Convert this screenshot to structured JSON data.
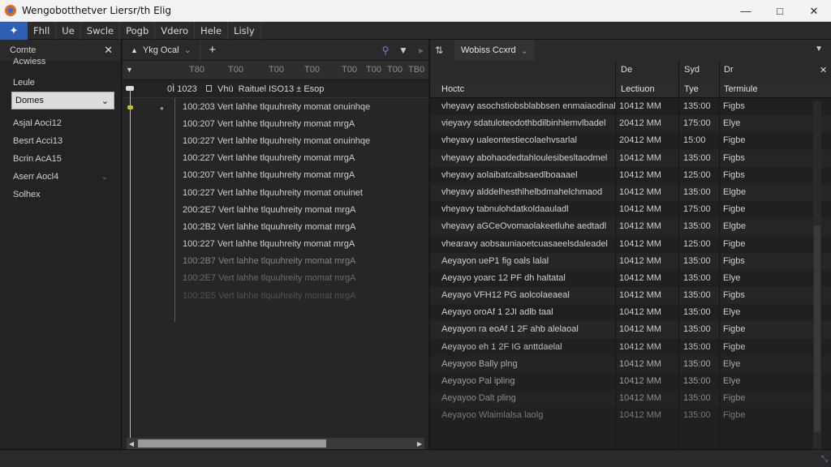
{
  "window": {
    "title": "Wengobotthetver Liersr/th Elig",
    "controls": [
      "—",
      "□",
      "✕"
    ]
  },
  "menu": {
    "logo": "✦",
    "items": [
      "Fhll",
      "Ue",
      "Swcle",
      "Pogb",
      "Vdero",
      "Hele",
      "Lisly"
    ]
  },
  "sidebar": {
    "title": "Comte",
    "close": "✕",
    "items": [
      {
        "label": "Acwiess"
      },
      {
        "label": "Leule"
      },
      {
        "label": "Domes",
        "selected": true
      },
      {
        "label": "Asjal Aoci12"
      },
      {
        "label": "Besrt Acci13"
      },
      {
        "label": "Bcrin AcA15"
      },
      {
        "label": "Aserr Aocl4",
        "chevron": true
      },
      {
        "label": "Solhex"
      }
    ]
  },
  "timeline": {
    "tab_label": "Ykg Ocal",
    "tab_prefix": "▲",
    "tab_chevron": "⌄",
    "add_label": "+",
    "ruler": [
      "T80",
      "T00",
      "T00",
      "T00",
      "T00",
      "T00",
      "T00",
      "TB0"
    ],
    "header_code": "0Ì 1023",
    "header_text": "Vhü  Raituel ISO13 ± Esop",
    "rows": [
      "100:203  Vert lahhe tlquuhreity momat onuinhqe",
      "100:207  Vert lahhe tlquuhreity momat mrgA",
      "100:227  Vert lahhe tlquuhreity momat onuinhqe",
      "100:227  Vert lahhe tlquuhreity momat mrgA",
      "100:207  Vert lahhe tlquuhreity momat mrgA",
      "100:227  Vert lahhe tlquuhreity momat onuinet",
      "200:2E7  Vert lahhe tlquuhreity momat mrgA",
      "100:2B2  Vert lahhe tlquuhreity momat mrgA",
      "100:227  Vert lahhe tlquuhreity momat mrgA",
      "100:2B7  Vert lahhe tlquuhreity momat mrgA",
      "100:2E7  Vert lahhe tlquuhreity momat mrgA",
      "100:2E5  Vert lahhe tlquuhreity momat mrgA"
    ]
  },
  "panel": {
    "tab_label": "Wobiss Ccxrd",
    "tab_chevron": "⌄",
    "menu": "▼",
    "top_headers": [
      "De",
      "Syd",
      "Dr"
    ],
    "top_action": "✕",
    "col_headers": [
      "Hoctc",
      "Lectiuon",
      "Tye",
      "Termiule"
    ],
    "rows": [
      {
        "desc": "vheyavy asochstiobsblabbsen enmaiaodinal",
        "time": "10412 MM",
        "dur": "135:00",
        "type": "Figbs"
      },
      {
        "desc": "vieyavy sdatuloteodothbdilbinhlemvlbadel",
        "time": "20412 MM",
        "dur": "175:00",
        "type": "Elye"
      },
      {
        "desc": "vheyavy ualeontestiecolaehvsarlal",
        "time": "20412 MM",
        "dur": "15:00",
        "type": "Figbe"
      },
      {
        "desc": "vheyavy abohaodedtahloulesibesltaodmel",
        "time": "10412 MM",
        "dur": "135:00",
        "type": "Figbs"
      },
      {
        "desc": "vheyavy aolaibatcaibsaedlboaaael",
        "time": "10412 MM",
        "dur": "125:00",
        "type": "Figbs"
      },
      {
        "desc": "vheyavy alddelhesthlhelbdmahelchmaod",
        "time": "10412 MM",
        "dur": "135:00",
        "type": "Elgbe"
      },
      {
        "desc": "vheyavy tabnulohdatkoldaauladl",
        "time": "10412 MM",
        "dur": "175:00",
        "type": "Figbe"
      },
      {
        "desc": "vheyavy aGCeOvomaolakeetluhe aedtadl",
        "time": "10412 MM",
        "dur": "135:00",
        "type": "Elgbe"
      },
      {
        "desc": "vhearavy aobsauniaoetcuasaeelsdaleadel",
        "time": "10412 MM",
        "dur": "125:00",
        "type": "Figbe"
      },
      {
        "desc": "Aeyayon ueP1 fig oals lalal",
        "time": "10412 MM",
        "dur": "135:00",
        "type": "Figbs"
      },
      {
        "desc": "Aeyayo yoarc 12 PF dh haltatal",
        "time": "10412 MM",
        "dur": "135:00",
        "type": "Elye"
      },
      {
        "desc": "Aeyayo VFH12 PG aolcolaeaeal",
        "time": "10412 MM",
        "dur": "135:00",
        "type": "Figbs"
      },
      {
        "desc": "Aeyayo oroAf 1 2JI adlb taal",
        "time": "10412 MM",
        "dur": "135:00",
        "type": "Elye"
      },
      {
        "desc": "Aeyayon ra eoAf 1 2F ahb alelaoal",
        "time": "10412 MM",
        "dur": "135:00",
        "type": "Figbe"
      },
      {
        "desc": "Aeyayoo eh 1 2F IG anttdaelal",
        "time": "10412 MM",
        "dur": "135:00",
        "type": "Figbe"
      },
      {
        "desc": "Aeyayoo Bally plng",
        "time": "10412 MM",
        "dur": "135:00",
        "type": "Elye"
      },
      {
        "desc": "Aeyayoo Pal ipling",
        "time": "10412 MM",
        "dur": "135:00",
        "type": "Elye"
      },
      {
        "desc": "Aeyayoo Dalt pling",
        "time": "10412 MM",
        "dur": "135:00",
        "type": "Figbe"
      },
      {
        "desc": "Aeyayoo Wlaimlalsa laolg",
        "time": "10412 MM",
        "dur": "135:00",
        "type": "Figbe"
      }
    ]
  },
  "status": {
    "grip": "⤡"
  }
}
